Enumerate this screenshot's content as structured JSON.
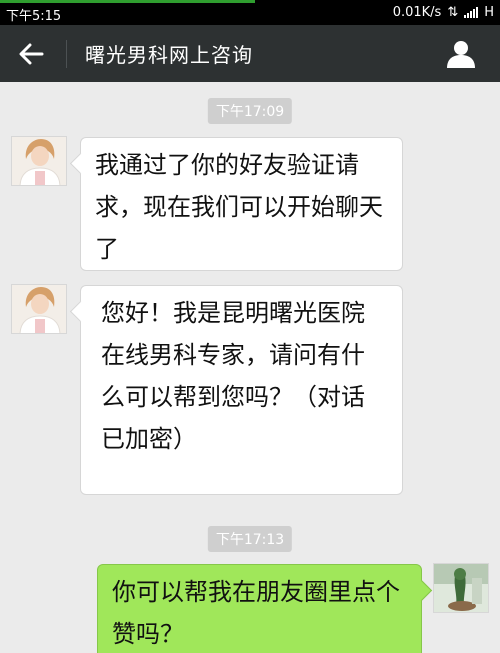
{
  "status_bar": {
    "time": "下午5:15",
    "network_speed": "0.01K/s",
    "network_type": "H"
  },
  "header": {
    "title": "曙光男科网上咨询",
    "back_icon": "arrow-left-icon",
    "profile_icon": "person-icon"
  },
  "messages": [
    {
      "type": "timestamp",
      "text": "下午17:09"
    },
    {
      "type": "incoming",
      "text": "我通过了你的好友验证请求，现在我们可以开始聊天了"
    },
    {
      "type": "incoming",
      "text": "您好！我是昆明曙光医院在线男科专家，请问有什么可以帮到您吗？（对话已加密）"
    },
    {
      "type": "timestamp",
      "text": "下午17:13"
    },
    {
      "type": "outgoing",
      "text": "你可以帮我在朋友圈里点个赞吗？"
    }
  ],
  "colors": {
    "title_bar": "#2d3132",
    "chat_background": "#ebebeb",
    "outgoing_bubble": "#a0e75a",
    "incoming_bubble": "#ffffff",
    "timestamp_chip": "#cfcfcf"
  }
}
